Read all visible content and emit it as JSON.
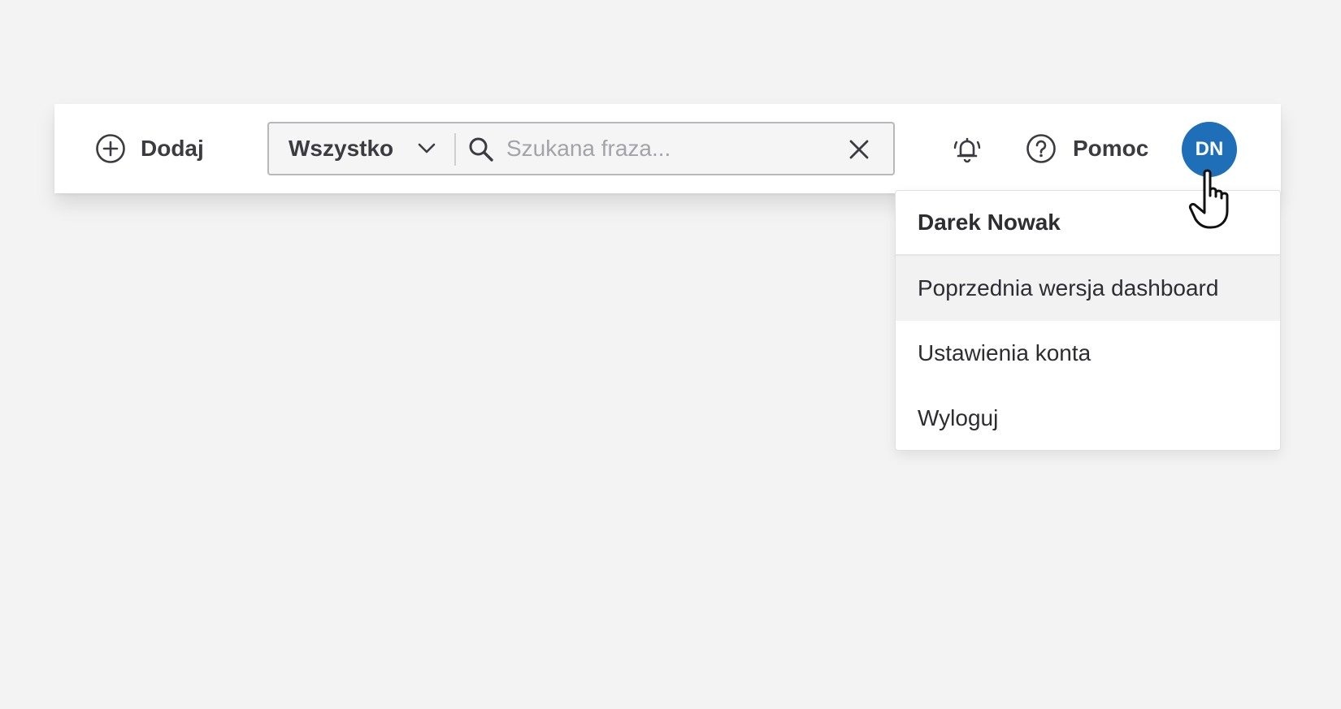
{
  "toolbar": {
    "add_label": "Dodaj",
    "help_label": "Pomoc",
    "avatar_initials": "DN",
    "avatar_color": "#1f6fb8"
  },
  "search": {
    "scope_value": "Wszystko",
    "placeholder": "Szukana fraza...",
    "value": ""
  },
  "icons": {
    "add": "plus-circle-icon",
    "scope_dropdown": "chevron-down-icon",
    "search": "search-icon",
    "clear": "close-icon",
    "notifications": "bell-icon",
    "help": "question-circle-icon",
    "pointer": "hand-pointer-cursor-icon"
  },
  "user_menu": {
    "user_name": "Darek Nowak",
    "items": [
      {
        "label": "Poprzednia wersja dashboard",
        "highlighted": true
      },
      {
        "label": "Ustawienia konta",
        "highlighted": false
      },
      {
        "label": "Wyloguj",
        "highlighted": false
      }
    ]
  }
}
